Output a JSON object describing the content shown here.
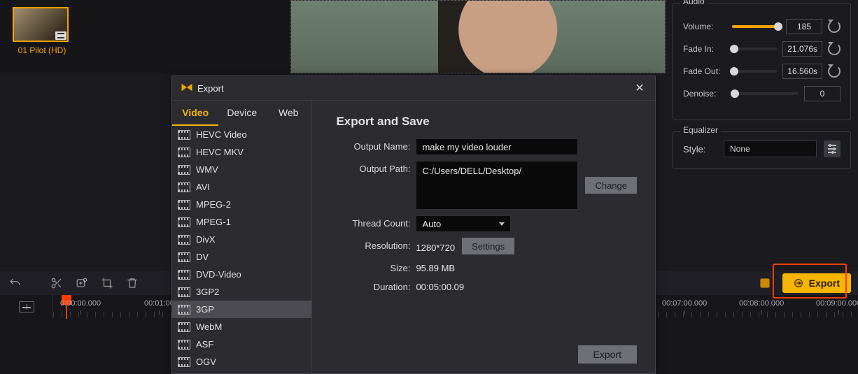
{
  "media_bin": {
    "clip_label": "01 Pilot (HD)"
  },
  "audio_panel": {
    "title": "Audio",
    "rows": {
      "volume": {
        "label": "Volume:",
        "value": "185",
        "knob_pct": 96,
        "active": true
      },
      "fade_in": {
        "label": "Fade In:",
        "value": "21.076s",
        "knob_pct": 0,
        "active": false
      },
      "fade_out": {
        "label": "Fade Out:",
        "value": "16.560s",
        "knob_pct": 0,
        "active": false
      },
      "denoise": {
        "label": "Denoise:",
        "value": "0",
        "knob_pct": 0,
        "active": false
      }
    }
  },
  "equalizer": {
    "title": "Equalizer",
    "style_label": "Style:",
    "style_value": "None"
  },
  "export_button": "Export",
  "timeline": {
    "playhead": "0:00:00.000",
    "ticks": [
      "00:01:00",
      "00:07:00.000",
      "00:08:00.000",
      "00:09:00.000"
    ]
  },
  "modal": {
    "title": "Export",
    "tabs": [
      "Video",
      "Device",
      "Web"
    ],
    "active_tab": 0,
    "formats": [
      "HEVC Video",
      "HEVC MKV",
      "WMV",
      "AVI",
      "MPEG-2",
      "MPEG-1",
      "DivX",
      "DV",
      "DVD-Video",
      "3GP2",
      "3GP",
      "WebM",
      "ASF",
      "OGV"
    ],
    "selected_format": "3GP",
    "right": {
      "heading": "Export and Save",
      "output_name_label": "Output Name:",
      "output_name": "make my video louder",
      "output_path_label": "Output Path:",
      "output_path": "C:/Users/DELL/Desktop/",
      "change_btn": "Change",
      "thread_label": "Thread Count:",
      "thread_value": "Auto",
      "resolution_label": "Resolution:",
      "resolution_value": "1280*720",
      "settings_btn": "Settings",
      "size_label": "Size:",
      "size_value": "95.89 MB",
      "duration_label": "Duration:",
      "duration_value": "00:05:00.09",
      "export_btn": "Export"
    }
  }
}
